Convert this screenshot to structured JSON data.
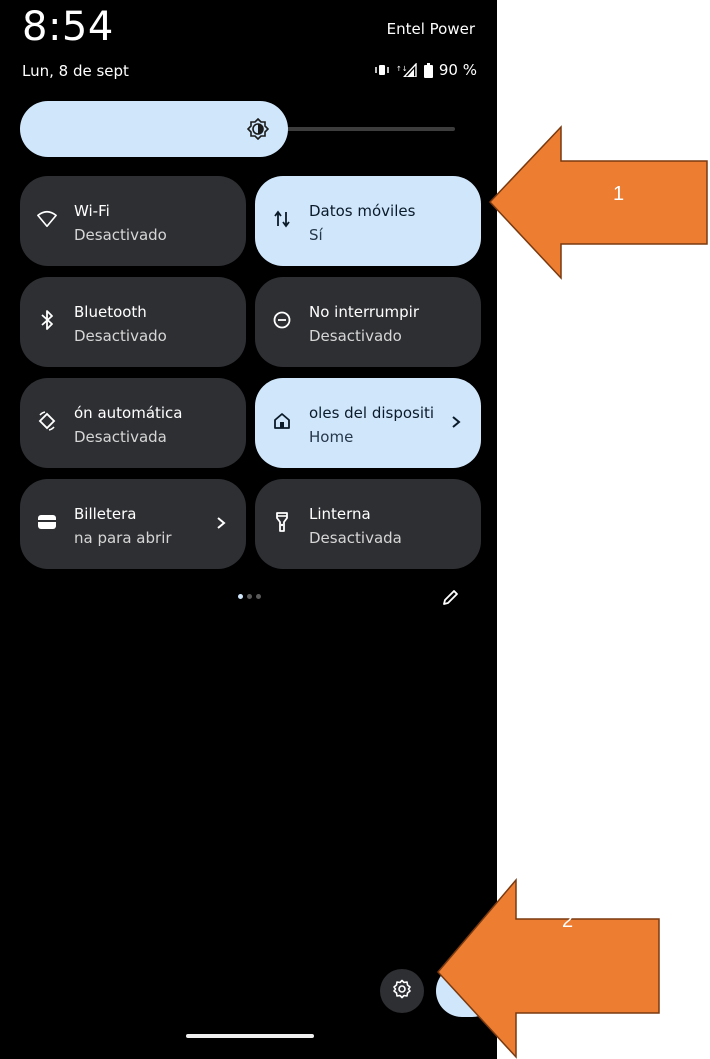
{
  "status_bar": {
    "time": "8:54",
    "carrier": "Entel Power",
    "date": "Lun, 8 de sept",
    "battery": "90 %"
  },
  "tiles": [
    {
      "title": "Wi-Fi",
      "subtitle": "Desactivado",
      "icon": "wifi-icon",
      "active": false
    },
    {
      "title": "Datos móviles",
      "subtitle": "Sí",
      "icon": "mobile-data-icon",
      "active": true
    },
    {
      "title": "Bluetooth",
      "subtitle": "Desactivado",
      "icon": "bluetooth-icon",
      "active": false
    },
    {
      "title": "No interrumpir",
      "subtitle": "Desactivado",
      "icon": "do-not-disturb-icon",
      "active": false
    },
    {
      "title": "ón automática",
      "subtitle": "Desactivada",
      "icon": "auto-rotate-icon",
      "active": false
    },
    {
      "title": "oles del dispositi",
      "subtitle": "Home",
      "icon": "home-icon",
      "active": true
    },
    {
      "title": "Billetera",
      "subtitle": "na para abrir",
      "icon": "wallet-icon",
      "active": false
    },
    {
      "title": "Linterna",
      "subtitle": "Desactivada",
      "icon": "flashlight-icon",
      "active": false
    }
  ],
  "annotations": [
    {
      "label": "1",
      "color": "#ed7d31"
    },
    {
      "label": "2",
      "color": "#ed7d31"
    }
  ],
  "colors": {
    "tile_active": "#cfe6fb",
    "tile_inactive": "#2e2f33",
    "background": "#000000",
    "annotation": "#ed7d31"
  },
  "brightness_level": 0.61,
  "page_indicator": {
    "pages": 3,
    "current": 1
  }
}
